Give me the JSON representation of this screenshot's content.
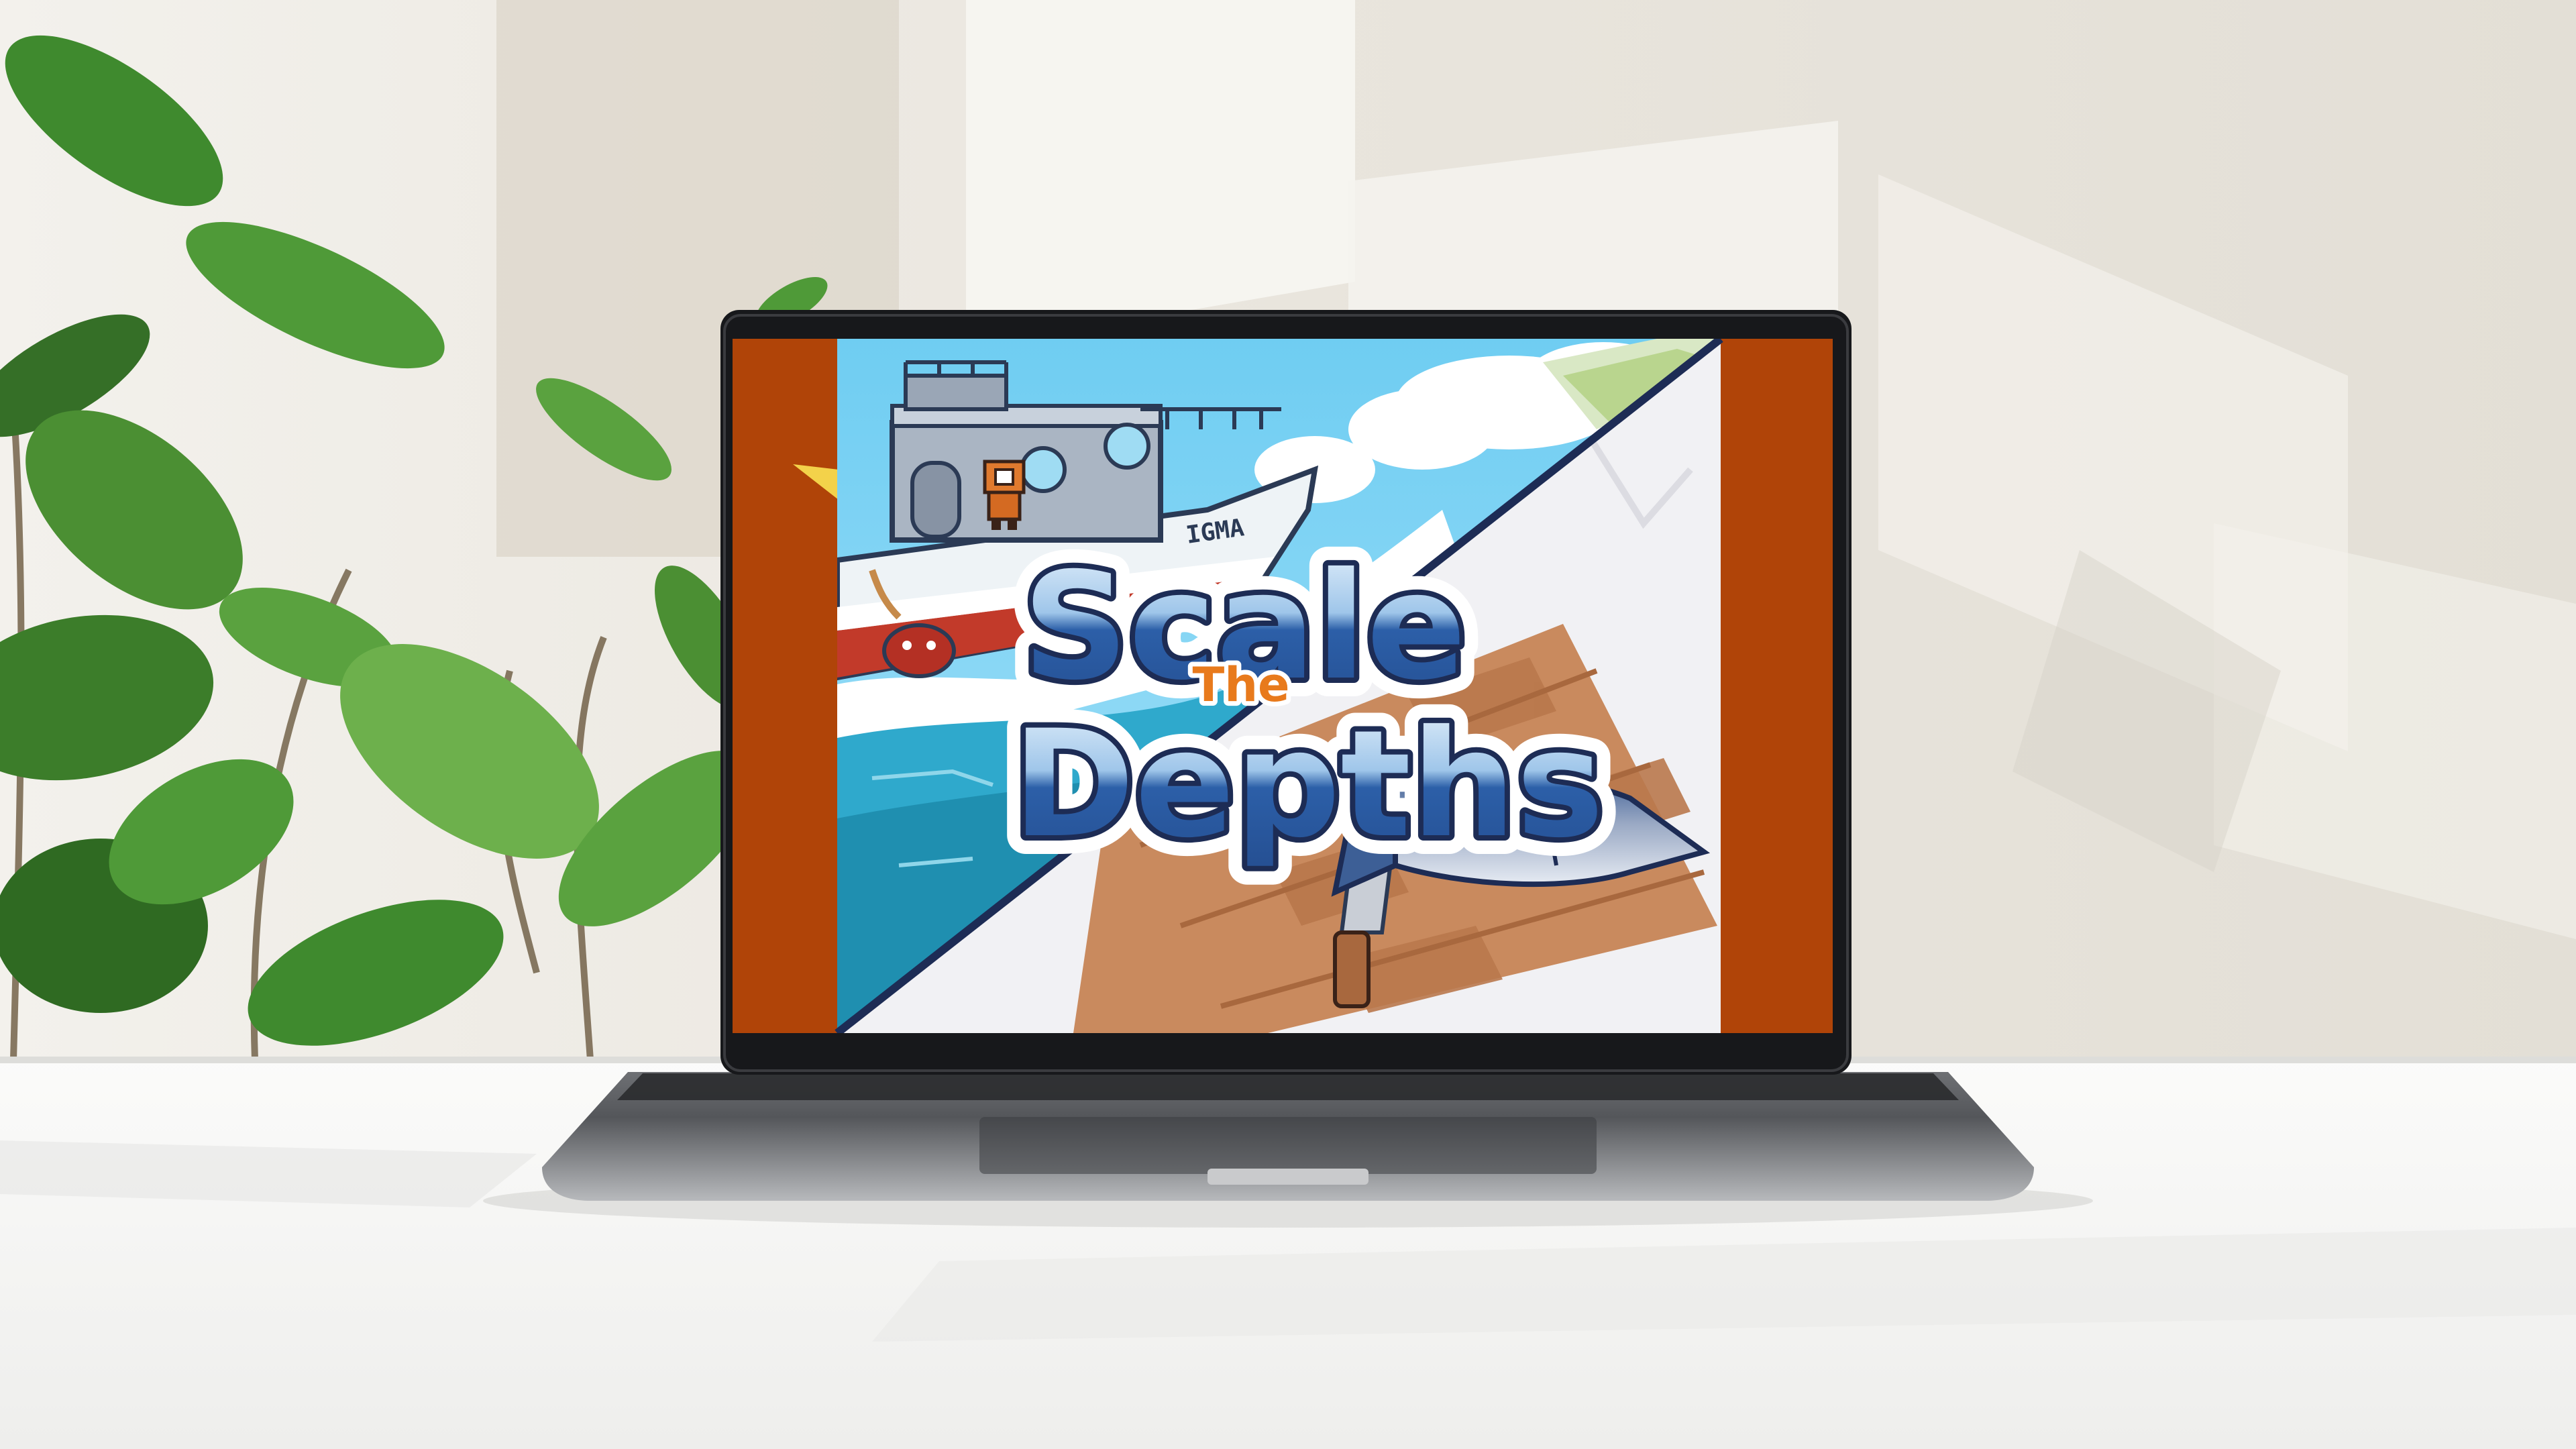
{
  "game": {
    "title_line1": "Scale",
    "title_connector": "The",
    "title_line2": "Depths",
    "boat_name": "IGMA"
  },
  "colors": {
    "pillarbox": "#b04408",
    "sky": "#7ed3f5",
    "water_deep": "#1f8fb0",
    "water_light": "#2fa9cc",
    "cutting_board": "#c98a5e",
    "title_blue": "#2c5fa8",
    "title_outline": "#1d2c55",
    "title_connector": "#e87a1c",
    "laptop_frame": "#17181b",
    "laptop_body": "#9a9ca0",
    "wall": "#ebe7e0",
    "desk": "#f4f4f4",
    "plant_leaf": "#3f8a2e"
  },
  "icons": {
    "boat": "fishing-boat-icon",
    "fisher": "fisher-character-icon",
    "fish": "fish-icon",
    "knife": "knife-icon",
    "buoy": "buoy-icon"
  }
}
